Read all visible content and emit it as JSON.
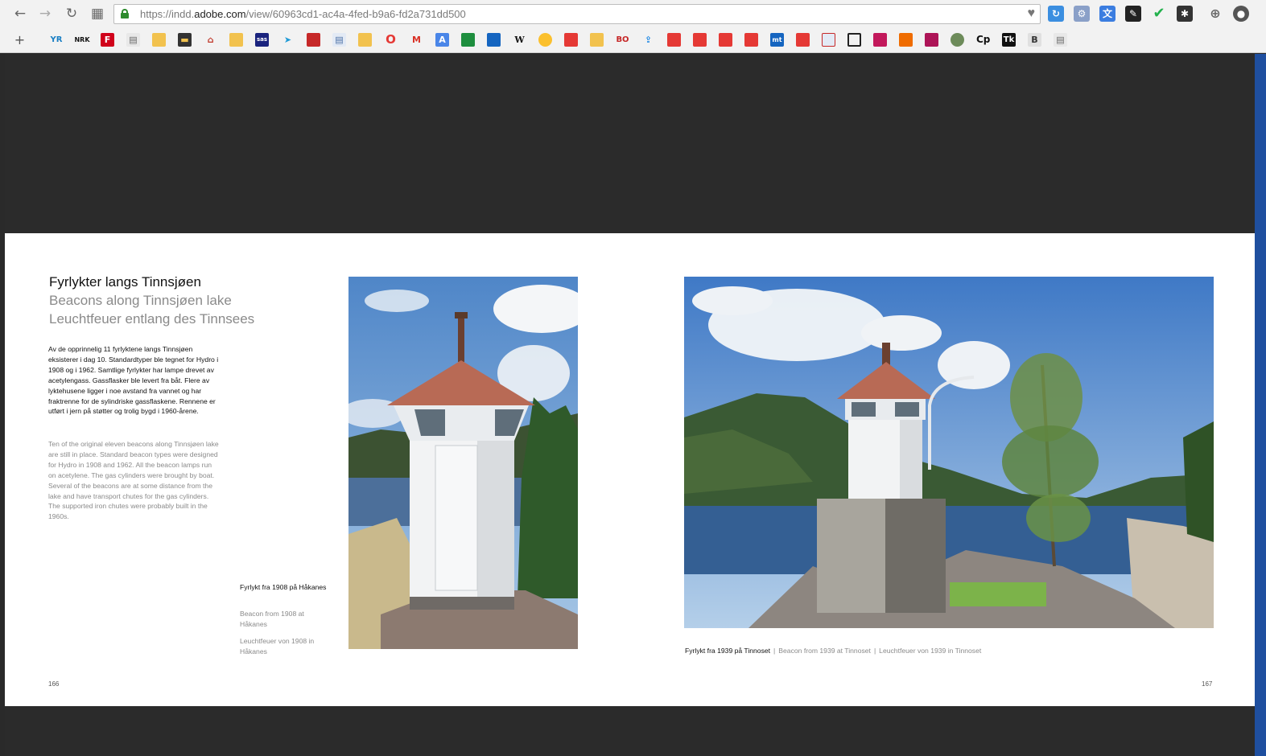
{
  "browser": {
    "url_prefix": "https://indd.",
    "url_domain": "adobe.com",
    "url_path": "/view/60963cd1-ac4a-4fed-b9a6-fd2a731dd500",
    "nav": {
      "back": "←",
      "forward": "→",
      "reload": "↻",
      "apps": "▦"
    },
    "bookmarks_add": "+",
    "bookmarks": [
      "YR",
      "NRK",
      "F",
      "W",
      "B",
      "Tk"
    ]
  },
  "spread": {
    "title_no": "Fyrlykter langs Tinnsjøen",
    "title_en": "Beacons along Tinnsjøen lake",
    "title_de": "Leuchtfeuer entlang des Tinnsees",
    "body_no": "Av de opprinnelig 11 fyrlyktene langs Tinnsjøen eksisterer i dag 10. Standardtyper ble tegnet for Hydro i 1908 og i 1962. Samtlige fyrlykter har lam­pe drevet av acetylengass. Gassflasker ble levert fra båt. Flere av lyktehusene ligger i noe avstand fra vannet og har fraktrenne for de sylindriske gassflaskene. Rennene er utført i jern på støtter og trolig bygd i 1960-årene.",
    "body_en": "Ten of the original eleven beacons along Tinnsjø­en lake are still in place. Standard beacon types were designed for Hydro in 1908 and 1962.  All the beacon lamps run on acetylene. The gas cylinders were brought by boat. Several of the beacons are at some distance from the lake and have transport chutes for the gas cylinders. The supported iron chutes were probably built in the 1960s.",
    "caption_left_no": "Fyrlykt fra 1908 på Håkanes",
    "caption_left_en": "Beacon from 1908 at Håkanes",
    "caption_left_de": "Leuchtfeuer von 1908 in Håkanes",
    "caption_right_no": "Fyrlykt fra 1939 på Tinnoset",
    "caption_right_en": "Beacon from 1939 at Tinnoset",
    "caption_right_de": "Leuchtfeuer von 1939 in Tinnoset",
    "caption_sep": "|",
    "page_left": "166",
    "page_right": "167"
  }
}
